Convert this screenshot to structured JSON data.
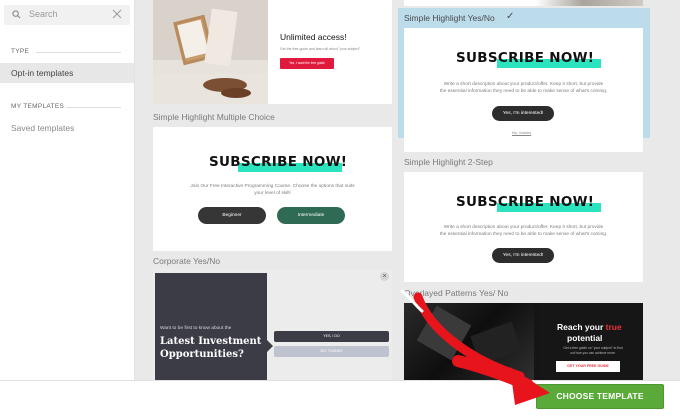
{
  "sidebar": {
    "search_placeholder": "Search",
    "type_heading": "TYPE",
    "type_items": [
      "Opt-in templates"
    ],
    "my_templates_heading": "MY TEMPLATES",
    "my_templates_items": [
      "Saved templates"
    ]
  },
  "templates": {
    "unlimited": {
      "headline": "Unlimited access!",
      "sub": "Get the free guide and learn all about \"your subject\"",
      "button": "Yes, I want the free guide"
    },
    "simple_multi": {
      "label": "Simple Highlight Multiple Choice",
      "title": "SUBSCRIBE NOW!",
      "desc_line1": "Join Our Free Interactive Programming Course. Choose the options that suits",
      "desc_line2": "your level of skill!",
      "btn_a": "Beginner",
      "btn_b": "Intermediate"
    },
    "corporate": {
      "label": "Corporate Yes/No",
      "kicker": "Want to be first to know about the",
      "headline_1": "Latest Investment",
      "headline_2": "Opportunities?",
      "yes": "YES, I DO",
      "no": "NO, THANKS",
      "close": "×"
    },
    "simple_yesno": {
      "label": "Simple Highlight Yes/No",
      "check": "✓",
      "title": "SUBSCRIBE NOW!",
      "desc_line1": "Write a short description about your product/offer. Keep it short, but provide",
      "desc_line2": "the essential information they need to be able to make sense of what's coming.",
      "cta": "Yes, I'm interested!",
      "no": "No, thanks"
    },
    "two_step": {
      "label": "Simple Highlight 2-Step",
      "title": "SUBSCRIBE NOW!",
      "desc_line1": "Write a short description about your product/offer. Keep it short, but provide",
      "desc_line2": "the essential information they need to be able to make sense of what's coming.",
      "cta": "Yes, I'm interested!"
    },
    "overlayed": {
      "label": "Overlayed Patterns Yes/ No",
      "reach": "Reach your",
      "true_word": "true",
      "potential": "potential",
      "sub_1": "Get a free guide on \"your subject\" to find",
      "sub_2": "out how you can achieve more.",
      "button": "GET YOUR FREE GUIDE"
    }
  },
  "footer": {
    "choose_label": "CHOOSE TEMPLATE"
  },
  "colors": {
    "accent_green": "#5aaa39",
    "highlight_teal": "#2be3bf",
    "selected_bg": "#bcdcec",
    "annotation_red": "#e8141c"
  }
}
